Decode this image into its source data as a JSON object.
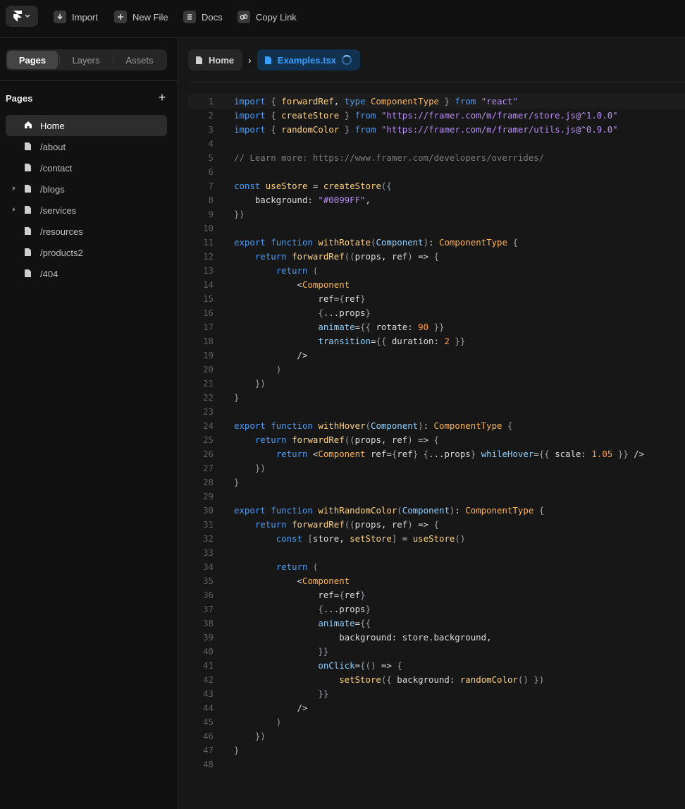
{
  "topbar": {
    "logo": "framer-icon",
    "buttons": [
      {
        "label": "Import",
        "icon": "download-icon"
      },
      {
        "label": "New File",
        "icon": "plus-icon"
      },
      {
        "label": "Docs",
        "icon": "docs-icon"
      },
      {
        "label": "Copy Link",
        "icon": "link-icon"
      }
    ]
  },
  "sidebar": {
    "tabs": [
      "Pages",
      "Layers",
      "Assets"
    ],
    "active_tab": "Pages",
    "section_title": "Pages",
    "pages": [
      {
        "label": "Home",
        "icon": "home-icon",
        "active": true,
        "expandable": false
      },
      {
        "label": "/about",
        "icon": "page-icon",
        "active": false,
        "expandable": false
      },
      {
        "label": "/contact",
        "icon": "page-icon",
        "active": false,
        "expandable": false
      },
      {
        "label": "/blogs",
        "icon": "page-icon",
        "active": false,
        "expandable": true
      },
      {
        "label": "/services",
        "icon": "page-icon",
        "active": false,
        "expandable": true
      },
      {
        "label": "/resources",
        "icon": "page-icon",
        "active": false,
        "expandable": false
      },
      {
        "label": "/products2",
        "icon": "page-icon",
        "active": false,
        "expandable": false
      },
      {
        "label": "/404",
        "icon": "page-icon",
        "active": false,
        "expandable": false
      }
    ]
  },
  "breadcrumb": {
    "home": "Home",
    "file": "Examples.tsx",
    "loading": true
  },
  "editor": {
    "current_line": 1,
    "lines": [
      "import { forwardRef, type ComponentType } from \"react\"",
      "import { createStore } from \"https://framer.com/m/framer/store.js@^1.0.0\"",
      "import { randomColor } from \"https://framer.com/m/framer/utils.js@^0.9.0\"",
      "",
      "// Learn more: https://www.framer.com/developers/overrides/",
      "",
      "const useStore = createStore({",
      "    background: \"#0099FF\",",
      "})",
      "",
      "export function withRotate(Component): ComponentType {",
      "    return forwardRef((props, ref) => {",
      "        return (",
      "            <Component",
      "                ref={ref}",
      "                {...props}",
      "                animate={{ rotate: 90 }}",
      "                transition={{ duration: 2 }}",
      "            />",
      "        )",
      "    })",
      "}",
      "",
      "export function withHover(Component): ComponentType {",
      "    return forwardRef((props, ref) => {",
      "        return <Component ref={ref} {...props} whileHover={{ scale: 1.05 }} />",
      "    })",
      "}",
      "",
      "export function withRandomColor(Component): ComponentType {",
      "    return forwardRef((props, ref) => {",
      "        const [store, setStore] = useStore()",
      "",
      "        return (",
      "            <Component",
      "                ref={ref}",
      "                {...props}",
      "                animate={{",
      "                    background: store.background,",
      "                }}",
      "                onClick={() => {",
      "                    setStore({ background: randomColor() })",
      "                }}",
      "            />",
      "        )",
      "    })",
      "}",
      ""
    ]
  }
}
